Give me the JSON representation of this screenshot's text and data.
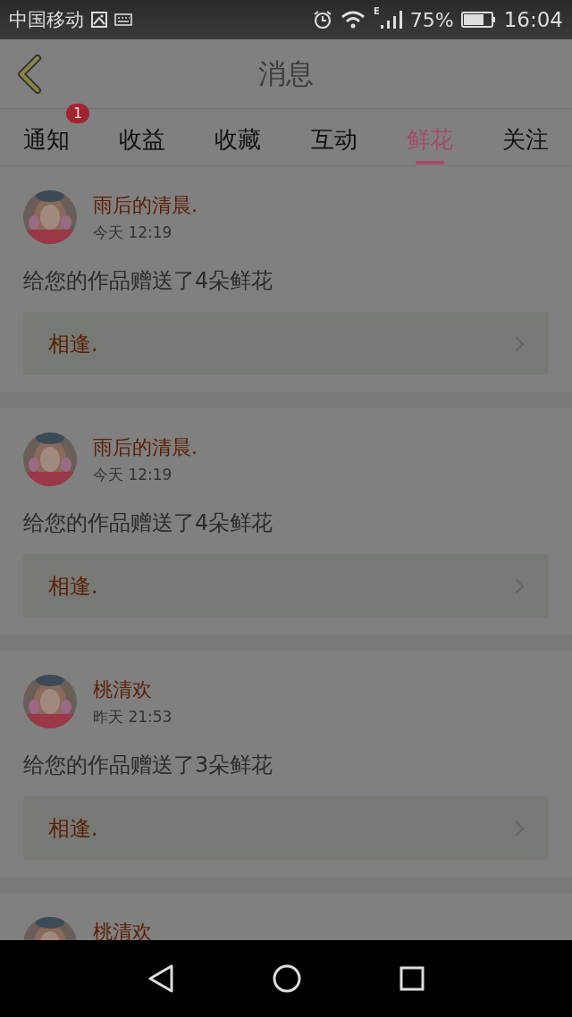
{
  "status_bar": {
    "carrier": "中国移动",
    "network": "E",
    "battery_percent": "75%",
    "time": "16:04"
  },
  "header": {
    "title": "消息"
  },
  "tabs": [
    {
      "label": "通知",
      "selected": false,
      "badge": "1"
    },
    {
      "label": "收益",
      "selected": false
    },
    {
      "label": "收藏",
      "selected": false
    },
    {
      "label": "互动",
      "selected": false
    },
    {
      "label": "鲜花",
      "selected": true
    },
    {
      "label": "关注",
      "selected": false
    }
  ],
  "messages": [
    {
      "name": "雨后的清晨.",
      "time": "今天 12:19",
      "text": "给您的作品赠送了4朵鲜花",
      "work": "相逢."
    },
    {
      "name": "雨后的清晨.",
      "time": "今天 12:19",
      "text": "给您的作品赠送了4朵鲜花",
      "work": "相逢."
    },
    {
      "name": "桃清欢",
      "time": "昨天 21:53",
      "text": "给您的作品赠送了3朵鲜花",
      "work": "相逢."
    },
    {
      "name": "桃清欢"
    }
  ]
}
